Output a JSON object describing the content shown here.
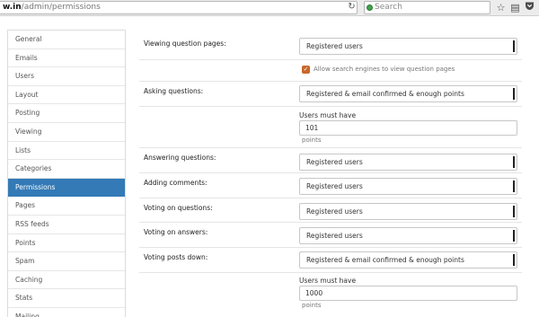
{
  "browser": {
    "url_host": "w.in",
    "url_path": "/admin/permissions",
    "search_placeholder": "Search",
    "icons": [
      "reload-icon",
      "search-engine-icon",
      "bookmark-star-icon",
      "reading-list-icon",
      "pocket-icon"
    ]
  },
  "sidebar": {
    "items": [
      {
        "label": "General"
      },
      {
        "label": "Emails"
      },
      {
        "label": "Users"
      },
      {
        "label": "Layout"
      },
      {
        "label": "Posting"
      },
      {
        "label": "Viewing"
      },
      {
        "label": "Lists"
      },
      {
        "label": "Categories"
      },
      {
        "label": "Permissions",
        "active": true
      },
      {
        "label": "Pages"
      },
      {
        "label": "RSS feeds"
      },
      {
        "label": "Points"
      },
      {
        "label": "Spam"
      },
      {
        "label": "Caching"
      },
      {
        "label": "Stats"
      },
      {
        "label": "Mailing"
      }
    ],
    "active_color": "#337ab7"
  },
  "permissions": {
    "viewing_question_pages": {
      "label": "Viewing question pages:",
      "value": "Registered users"
    },
    "allow_search_engines": {
      "label": "Allow search engines to view question pages",
      "checked": true
    },
    "asking_questions": {
      "label": "Asking questions:",
      "value": "Registered & email confirmed & enough points",
      "min_points_label": "Users must have",
      "min_points": "101",
      "units": "points"
    },
    "answering_questions": {
      "label": "Answering questions:",
      "value": "Registered users"
    },
    "adding_comments": {
      "label": "Adding comments:",
      "value": "Registered users"
    },
    "voting_on_questions": {
      "label": "Voting on questions:",
      "value": "Registered users"
    },
    "voting_on_answers": {
      "label": "Voting on answers:",
      "value": "Registered users"
    },
    "voting_posts_down": {
      "label": "Voting posts down:",
      "value": "Registered & email confirmed & enough points",
      "min_points_label": "Users must have",
      "min_points": "1000",
      "units": "points"
    }
  }
}
